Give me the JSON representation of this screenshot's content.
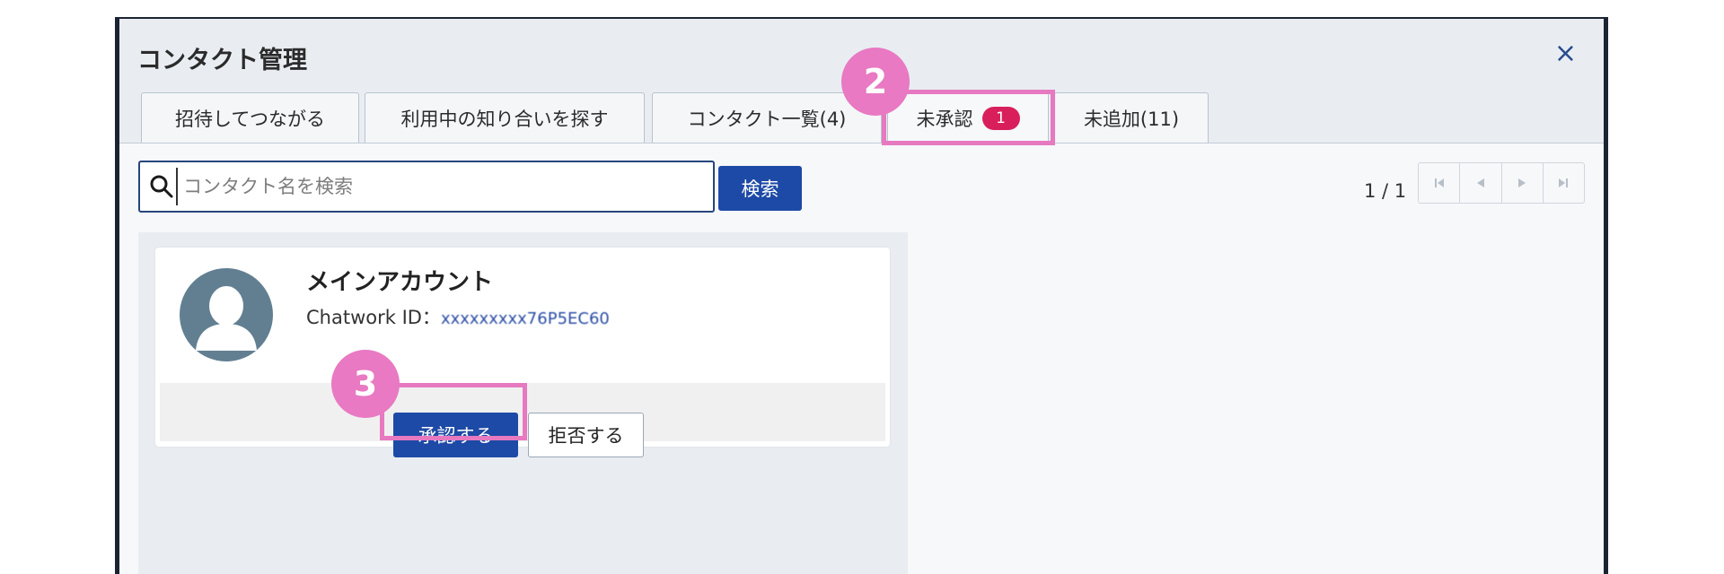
{
  "modal": {
    "title": "コンタクト管理",
    "close_label": "×"
  },
  "tabs": [
    {
      "label": "招待してつながる"
    },
    {
      "label": "利用中の知り合いを探す"
    },
    {
      "label": "コンタクト一覧(4)"
    },
    {
      "label": "未承認",
      "badge": "1",
      "active": true
    },
    {
      "label": "未追加(11)"
    }
  ],
  "annotations": {
    "step_tab": "2",
    "step_approve": "3",
    "highlight_color": "#e779c0"
  },
  "search": {
    "placeholder": "コンタクト名を検索",
    "value": "",
    "button_label": "検索"
  },
  "pager": {
    "count": "1 / 1",
    "buttons": [
      "first-page-icon",
      "prev-page-icon",
      "next-page-icon",
      "last-page-icon"
    ]
  },
  "contact": {
    "name": "メインアカウント",
    "id_label": "Chatwork ID：",
    "id_value": "xxxxxxxxx76P5EC60",
    "avatar_icon": "person-silhouette-icon"
  },
  "actions": {
    "approve_label": "承認する",
    "reject_label": "拒否する"
  },
  "colors": {
    "primary": "#1d4aa6",
    "badge": "#d81f5c",
    "header_bg": "#e9edf2"
  }
}
